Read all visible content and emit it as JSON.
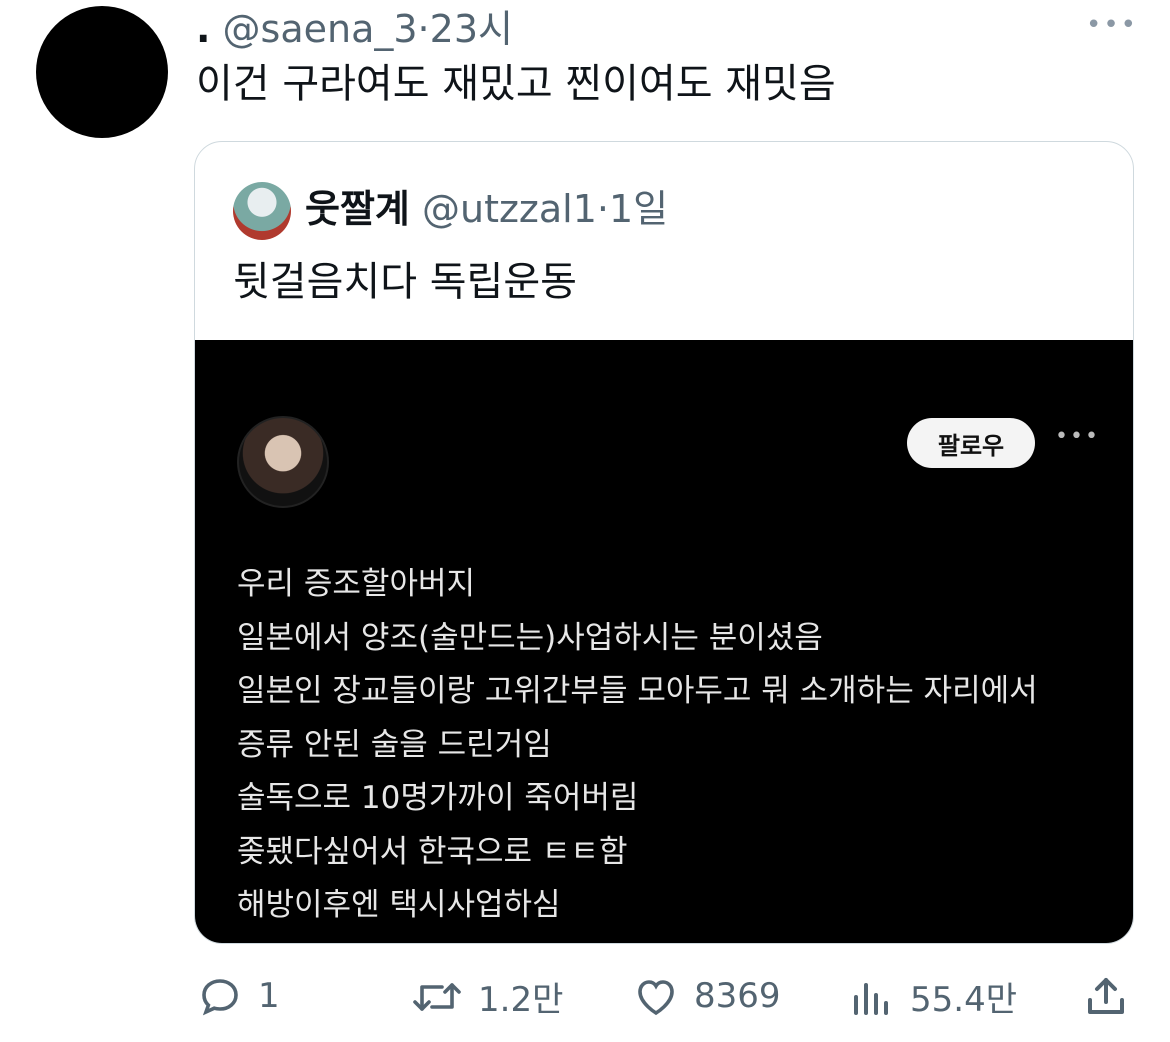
{
  "tweet": {
    "author_name": ".",
    "handle": "@saena_3",
    "separator": "·",
    "time": "23시",
    "text": "이건 구라여도 재밌고 찐이여도 재밋음",
    "more_icon": "more-horizontal-icon"
  },
  "quoted": {
    "author_name": "웃짤계",
    "handle": "@utzzal1",
    "separator": "·",
    "time": "1일",
    "text": "뒷걸음치다 독립운동",
    "media": {
      "follow_label": "팔로우",
      "more_icon": "more-horizontal-icon",
      "lines": [
        "우리 증조할아버지",
        "일본에서 양조(술만드는)사업하시는 분이셨음",
        "일본인 장교들이랑 고위간부들 모아두고 뭐 소개하는 자리에서",
        "증류 안된 술을 드린거임",
        "술독으로 10명가까이 죽어버림",
        "좆됐다싶어서 한국으로 ㅌㅌ함",
        "해방이후엔 택시사업하심"
      ]
    }
  },
  "actions": {
    "reply_count": "1",
    "retweet_count": "1.2만",
    "like_count": "8369",
    "views_count": "55.4만",
    "icons": [
      "reply-icon",
      "retweet-icon",
      "like-icon",
      "views-icon",
      "share-icon"
    ]
  },
  "colors": {
    "muted": "#536471",
    "text": "#0f1419",
    "border": "#cfd9de",
    "media_bg": "#000000"
  }
}
